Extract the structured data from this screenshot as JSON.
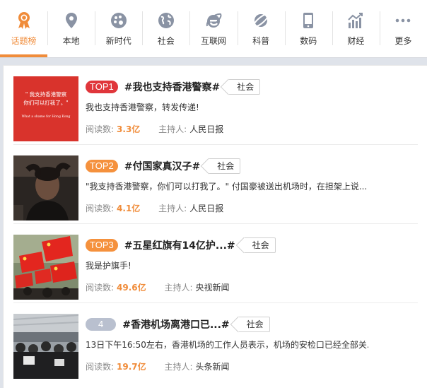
{
  "nav": {
    "items": [
      {
        "label": "话题榜",
        "icon": "medal-icon"
      },
      {
        "label": "本地",
        "icon": "location-pin-icon"
      },
      {
        "label": "新时代",
        "icon": "palette-icon"
      },
      {
        "label": "社会",
        "icon": "globe-icon"
      },
      {
        "label": "互联网",
        "icon": "internet-explorer-icon"
      },
      {
        "label": "科普",
        "icon": "planet-icon"
      },
      {
        "label": "数码",
        "icon": "phone-icon"
      },
      {
        "label": "财经",
        "icon": "chart-icon"
      },
      {
        "label": "更多",
        "icon": "more-icon"
      }
    ],
    "active_index": 0,
    "accent_color": "#f08c3a"
  },
  "meta_labels": {
    "reads": "阅读数:",
    "host": "主持人:"
  },
  "topics": [
    {
      "rank": "TOP1",
      "title": "#我也支持香港警察#",
      "tag": "社会",
      "desc": "我也支持香港警察，转发传递!",
      "reads": "3.3亿",
      "host": "人民日报",
      "thumb": {
        "line1": "\" 我支持香港警察",
        "line2": "你们可以打我了。\"",
        "line3": "What a shame for Hong Kong"
      }
    },
    {
      "rank": "TOP2",
      "title": "#付国家真汉子#",
      "tag": "社会",
      "desc": "\"我支持香港警察，你们可以打我了。\" 付国豪被送出机场时，在担架上说...",
      "reads": "4.1亿",
      "host": "人民日报"
    },
    {
      "rank": "TOP3",
      "title": "#五星红旗有14亿护...#",
      "tag": "社会",
      "desc": "我是护旗手!",
      "reads": "49.6亿",
      "host": "央视新闻"
    },
    {
      "rank": "4",
      "title": "#香港机场离港口已...#",
      "tag": "社会",
      "desc": "13日下午16:50左右，香港机场的工作人员表示，机场的安检口已经全部关...",
      "reads": "19.7亿",
      "host": "头条新闻"
    }
  ]
}
